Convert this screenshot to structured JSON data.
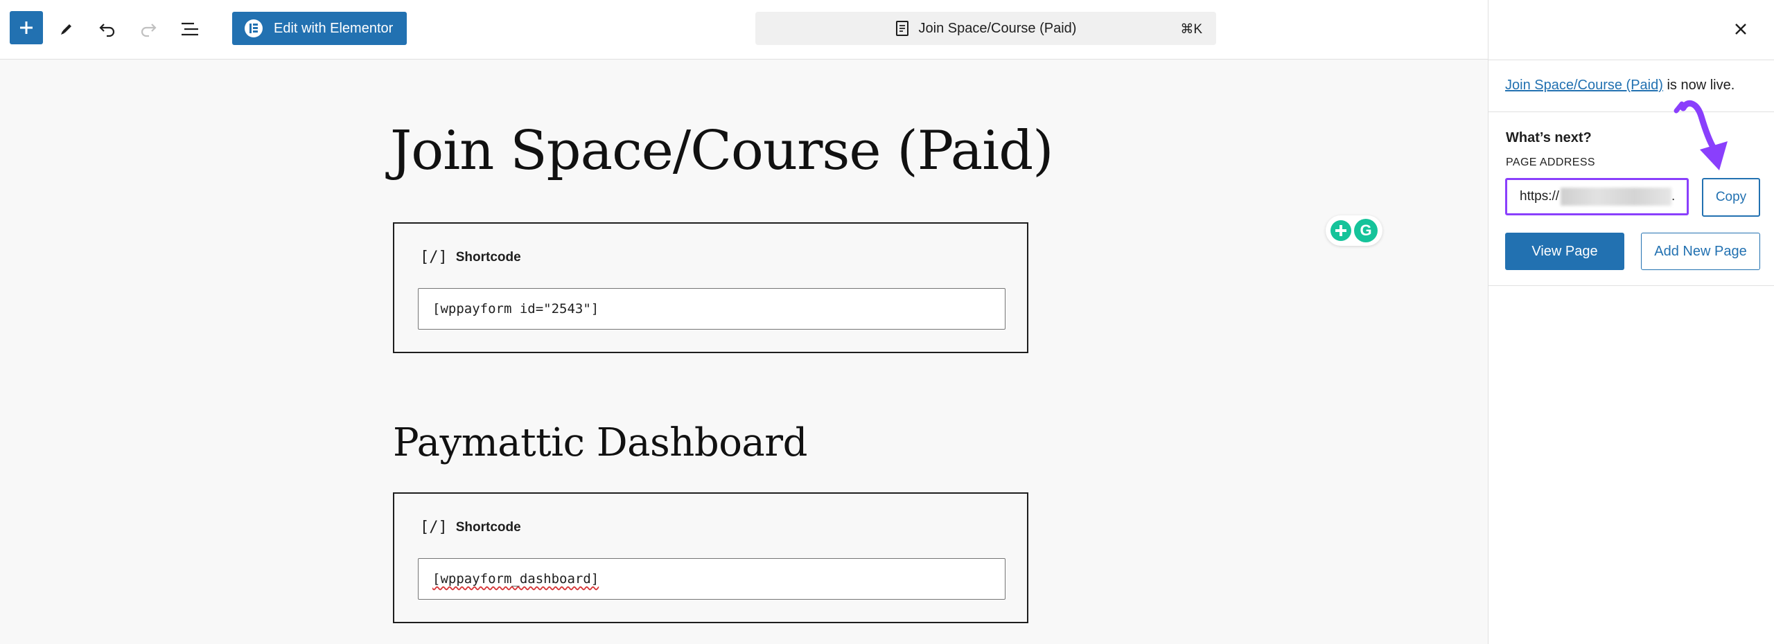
{
  "toolbar": {
    "elementor_label": "Edit with Elementor",
    "document_title": "Join Space/Course (Paid)",
    "shortcut": "⌘K",
    "icons": [
      "plus-icon",
      "pencil-icon",
      "undo-icon",
      "redo-icon",
      "list-view-icon",
      "close-icon"
    ]
  },
  "editor": {
    "page_title": "Join Space/Course (Paid)",
    "blocks": [
      {
        "label": "Shortcode",
        "icon": "[/]",
        "value": "[wppayform id=\"2543\"]"
      },
      {
        "label": "Shortcode",
        "icon": "[/]",
        "value": "[wppayform_dashboard]"
      }
    ],
    "section_heading": "Paymattic Dashboard"
  },
  "panel": {
    "live_link": "Join Space/Course (Paid)",
    "live_suffix": " is now live.",
    "whats_next": "What’s next?",
    "address_label": "PAGE ADDRESS",
    "address_prefix": "https://",
    "address_suffix": ".",
    "copy_label": "Copy",
    "view_page_label": "View Page",
    "add_new_label": "Add New Page"
  },
  "colors": {
    "primary": "#2271b1",
    "highlight": "#8a3ffc",
    "grammarly": "#15c39a"
  }
}
